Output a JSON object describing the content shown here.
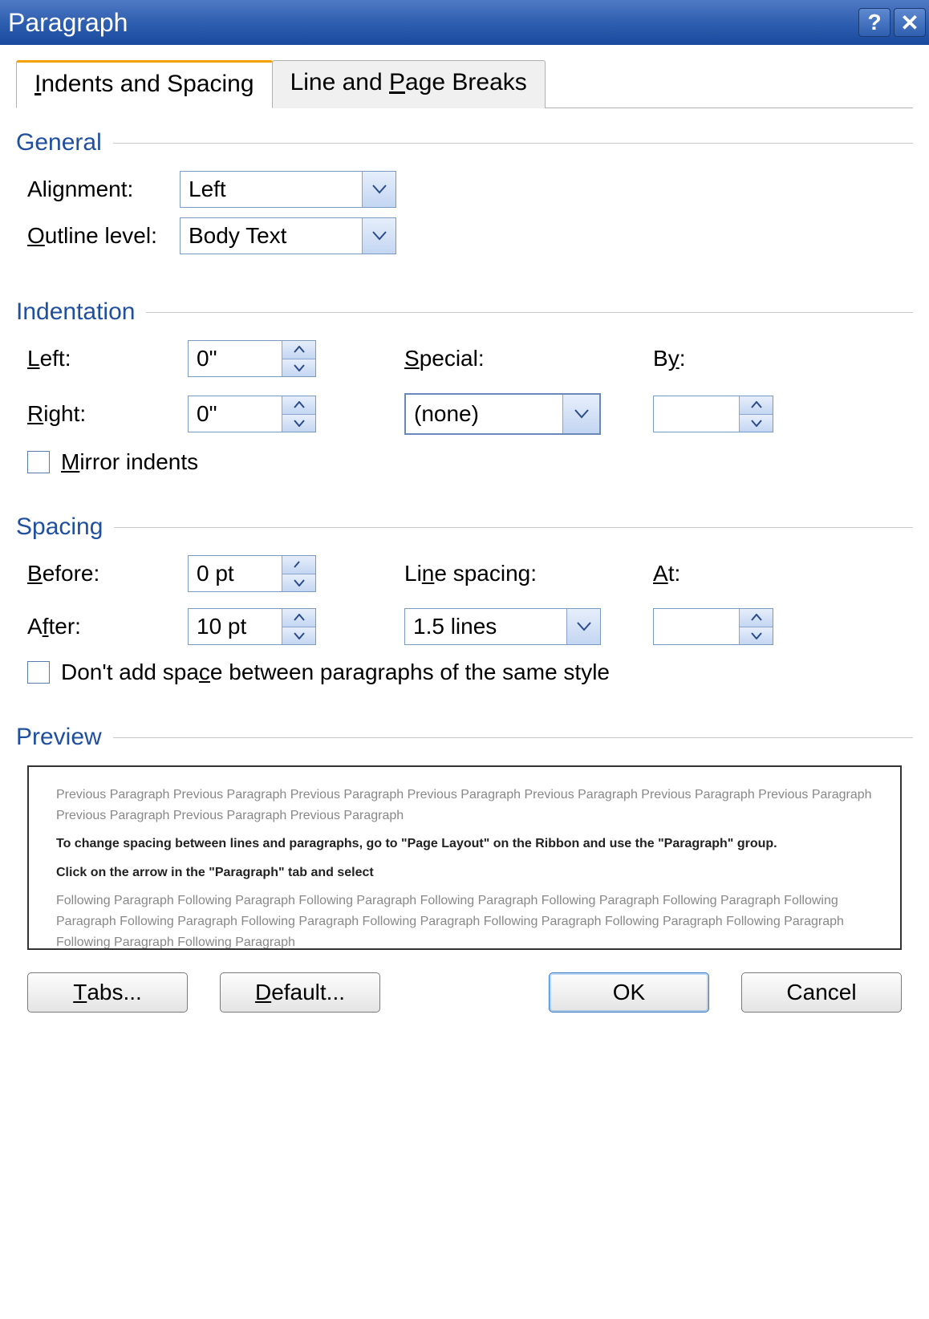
{
  "window": {
    "title": "Paragraph"
  },
  "tabs": {
    "indents_spacing": "Indents and Spacing",
    "line_page_breaks": "Line and Page Breaks"
  },
  "sections": {
    "general": "General",
    "indentation": "Indentation",
    "spacing": "Spacing",
    "preview": "Preview"
  },
  "general": {
    "alignment_label": "Alignment:",
    "alignment_value": "Left",
    "outline_label": "Outline level:",
    "outline_value": "Body Text"
  },
  "indentation": {
    "left_label": "Left:",
    "left_value": "0\"",
    "right_label": "Right:",
    "right_value": "0\"",
    "special_label": "Special:",
    "special_value": "(none)",
    "by_label": "By:",
    "by_value": "",
    "mirror_label": "Mirror indents"
  },
  "spacing": {
    "before_label": "Before:",
    "before_value": "0 pt",
    "after_label": "After:",
    "after_value": "10 pt",
    "line_spacing_label": "Line spacing:",
    "line_spacing_value": "1.5 lines",
    "at_label": "At:",
    "at_value": "",
    "dont_add_label": "Don't add space between paragraphs of the same style"
  },
  "preview": {
    "prev_text": "Previous Paragraph Previous Paragraph Previous Paragraph Previous Paragraph Previous Paragraph Previous Paragraph Previous Paragraph Previous Paragraph Previous Paragraph Previous Paragraph",
    "sample1": "To change spacing between lines and paragraphs, go to \"Page Layout\" on the Ribbon and use the \"Paragraph\" group.",
    "sample2": "Click on the arrow in the \"Paragraph\" tab and select",
    "next_text": "Following Paragraph Following Paragraph Following Paragraph Following Paragraph Following Paragraph Following Paragraph Following Paragraph Following Paragraph Following Paragraph Following Paragraph Following Paragraph Following Paragraph Following Paragraph Following Paragraph Following Paragraph"
  },
  "buttons": {
    "tabs": "Tabs...",
    "default": "Default...",
    "ok": "OK",
    "cancel": "Cancel"
  }
}
